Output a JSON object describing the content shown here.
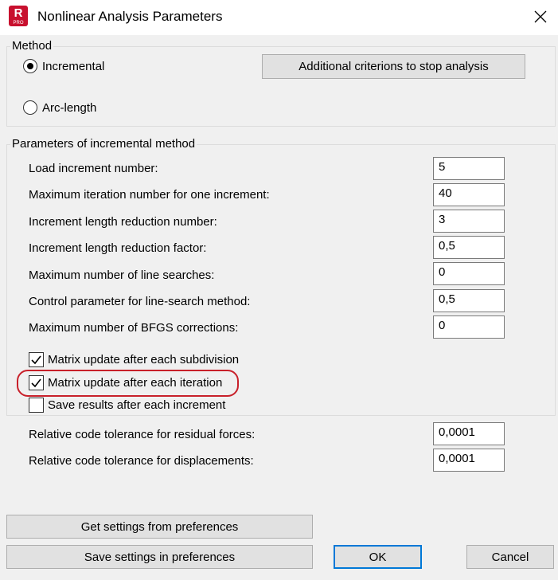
{
  "window": {
    "title": "Nonlinear Analysis Parameters",
    "app_icon_letter": "R",
    "app_icon_sub": "PRO"
  },
  "method": {
    "group_title": "Method",
    "incremental_label": "Incremental",
    "arc_length_label": "Arc-length",
    "selected": "incremental",
    "stop_button": "Additional criterions to stop analysis"
  },
  "params": {
    "group_title": "Parameters of incremental method",
    "rows": [
      {
        "label": "Load increment number:",
        "value": "5"
      },
      {
        "label": "Maximum iteration number for one increment:",
        "value": "40"
      },
      {
        "label": "Increment length reduction number:",
        "value": "3"
      },
      {
        "label": "Increment length reduction factor:",
        "value": "0,5"
      },
      {
        "label": "Maximum number of line searches:",
        "value": "0"
      },
      {
        "label": "Control parameter for line-search method:",
        "value": "0,5"
      },
      {
        "label": "Maximum number of BFGS corrections:",
        "value": "0"
      }
    ],
    "checks": [
      {
        "label": "Matrix update after each subdivision",
        "checked": true
      },
      {
        "label": "Matrix update after each iteration",
        "checked": true
      },
      {
        "label": "Save results after each increment",
        "checked": false
      }
    ]
  },
  "tolerances": [
    {
      "label": "Relative code tolerance for residual forces:",
      "value": "0,0001"
    },
    {
      "label": "Relative code tolerance for displacements:",
      "value": "0,0001"
    }
  ],
  "buttons": {
    "get_settings": "Get settings from preferences",
    "save_settings": "Save settings in preferences",
    "ok": "OK",
    "cancel": "Cancel"
  }
}
